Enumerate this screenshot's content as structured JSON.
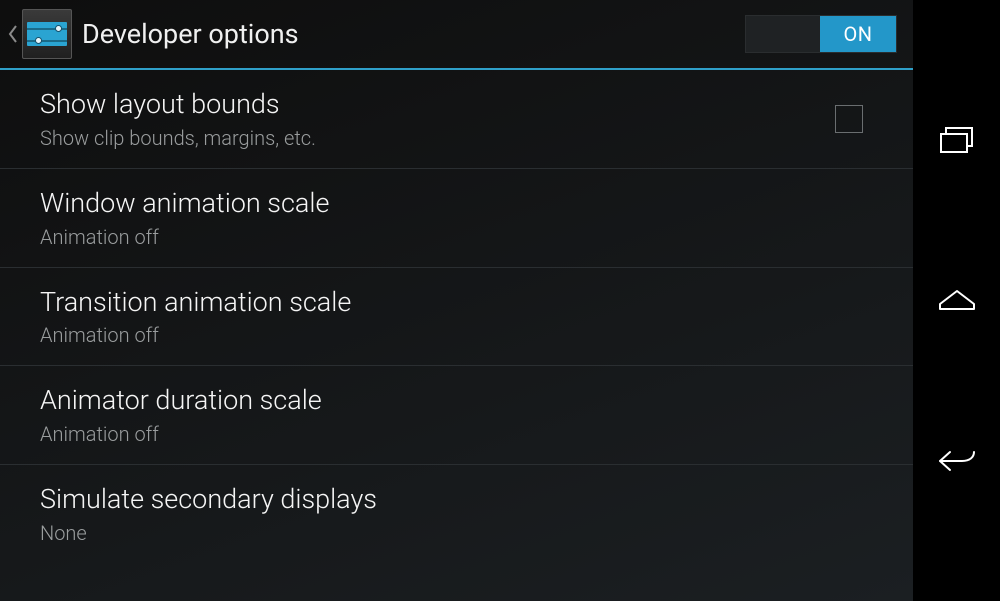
{
  "header": {
    "title": "Developer options",
    "switch_label": "ON",
    "switch_on": true
  },
  "settings": [
    {
      "title": "Show layout bounds",
      "subtitle": "Show clip bounds, margins, etc.",
      "has_checkbox": true,
      "checked": false
    },
    {
      "title": "Window animation scale",
      "subtitle": "Animation off",
      "has_checkbox": false
    },
    {
      "title": "Transition animation scale",
      "subtitle": "Animation off",
      "has_checkbox": false
    },
    {
      "title": "Animator duration scale",
      "subtitle": "Animation off",
      "has_checkbox": false
    },
    {
      "title": "Simulate secondary displays",
      "subtitle": "None",
      "has_checkbox": false
    }
  ],
  "navbar": {
    "recent": "recent-apps",
    "home": "home",
    "back": "back"
  }
}
